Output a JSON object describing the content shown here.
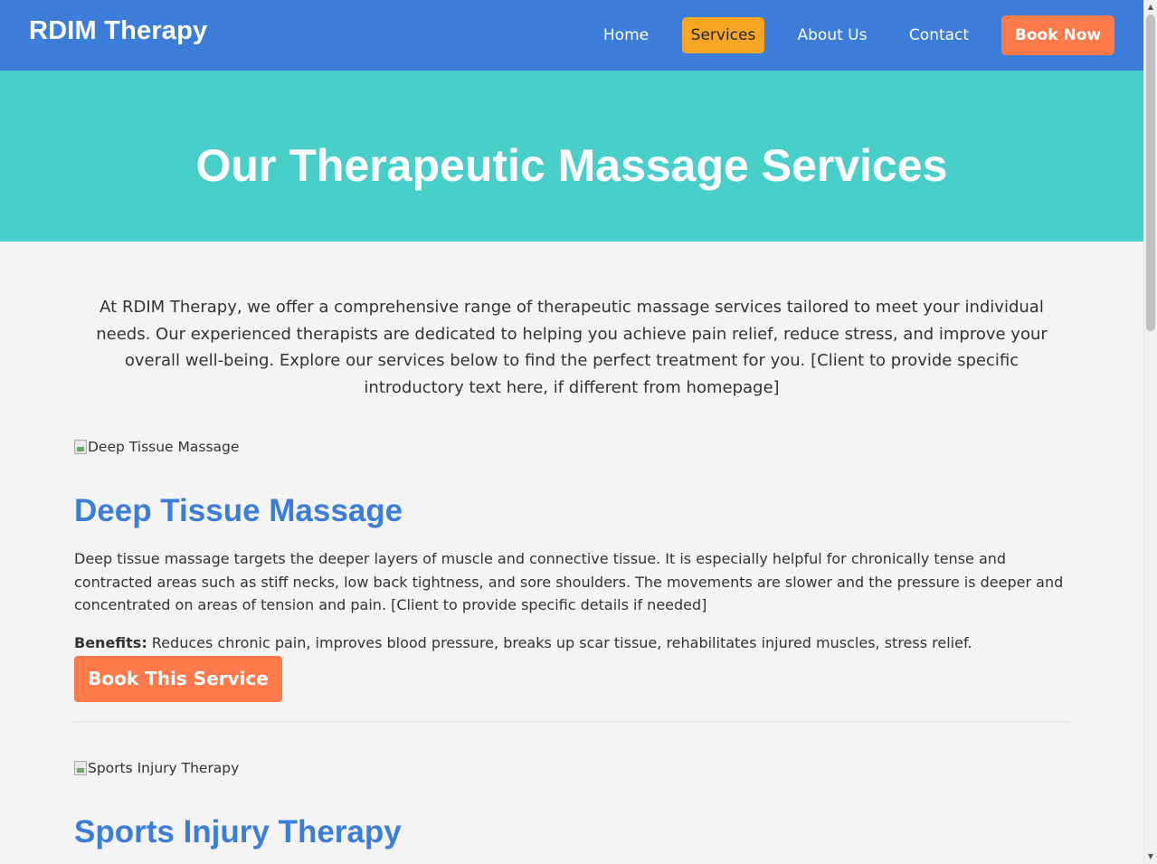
{
  "header": {
    "brand": "RDIM Therapy",
    "nav": {
      "home": "Home",
      "services": "Services",
      "about": "About Us",
      "contact": "Contact",
      "book": "Book Now"
    },
    "active_tab": "Services",
    "colors": {
      "header_bg": "#3b7dd8",
      "active_bg": "#f6a623",
      "cta_bg": "#ff7a4a"
    }
  },
  "hero": {
    "title": "Our Therapeutic Massage Services",
    "bg_color": "#48cfca"
  },
  "intro": "At RDIM Therapy, we offer a comprehensive range of therapeutic massage services tailored to meet your individual needs. Our experienced therapists are dedicated to helping you achieve pain relief, reduce stress, and improve your overall well-being. Explore our services below to find the perfect treatment for you. [Client to provide specific introductory text here, if different from homepage]",
  "services": [
    {
      "image_alt": "Deep Tissue Massage",
      "title": "Deep Tissue Massage",
      "description": "Deep tissue massage targets the deeper layers of muscle and connective tissue. It is especially helpful for chronically tense and contracted areas such as stiff necks, low back tightness, and sore shoulders. The movements are slower and the pressure is deeper and concentrated on areas of tension and pain. [Client to provide specific details if needed]",
      "benefits_label": "Benefits:",
      "benefits_text": " Reduces chronic pain, improves blood pressure, breaks up scar tissue, rehabilitates injured muscles, stress relief.",
      "button": "Book This Service"
    },
    {
      "image_alt": "Sports Injury Therapy",
      "title": "Sports Injury Therapy"
    }
  ]
}
